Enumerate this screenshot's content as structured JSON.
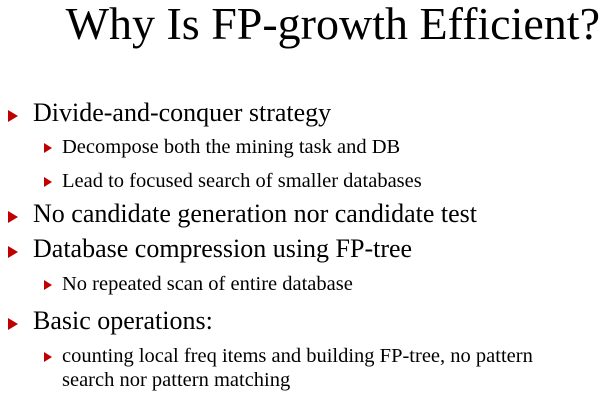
{
  "slide": {
    "title": "Why Is FP-growth Efficient?",
    "bullet_color": "#c00000",
    "items": [
      {
        "level": 1,
        "text": "Divide-and-conquer strategy"
      },
      {
        "level": 2,
        "text": "Decompose both the mining task and DB"
      },
      {
        "level": 2,
        "text": "Lead to focused search of smaller databases"
      },
      {
        "level": 1,
        "text": "No candidate generation nor candidate test"
      },
      {
        "level": 1,
        "text": "Database compression using FP-tree"
      },
      {
        "level": 2,
        "text": "No repeated scan of entire database"
      },
      {
        "level": 1,
        "text": "Basic operations:"
      },
      {
        "level": 2,
        "text": "counting local freq items and building FP-tree, no pattern search nor pattern matching"
      }
    ]
  }
}
